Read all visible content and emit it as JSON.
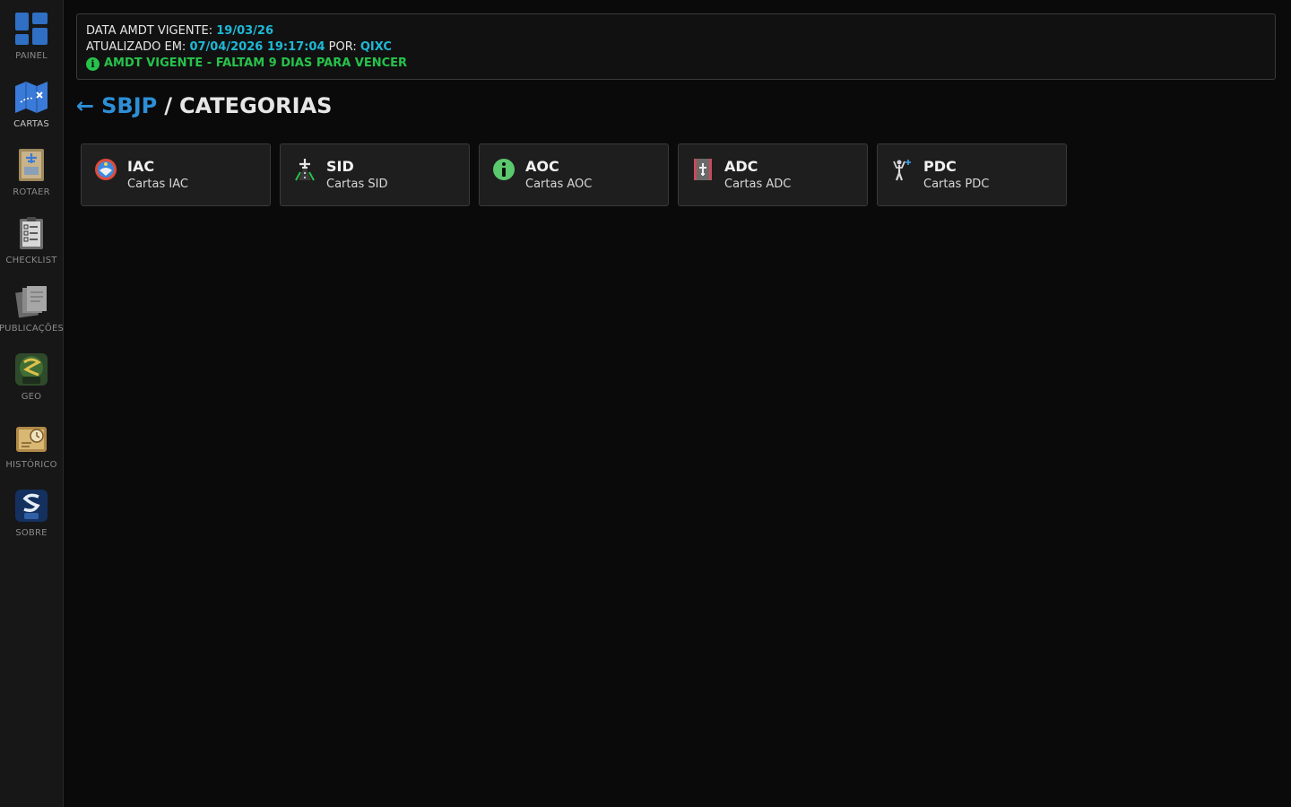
{
  "sidebar": {
    "items": [
      {
        "label": "PAINEL",
        "icon": "dashboard-icon"
      },
      {
        "label": "CARTAS",
        "icon": "map-icon"
      },
      {
        "label": "ROTAER",
        "icon": "rotaer-icon"
      },
      {
        "label": "CHECKLIST",
        "icon": "checklist-icon"
      },
      {
        "label": "PUBLICAÇÕES",
        "icon": "publications-icon"
      },
      {
        "label": "GEO",
        "icon": "sophia-geo-icon"
      },
      {
        "label": "HISTÓRICO",
        "icon": "history-icon"
      },
      {
        "label": "SOBRE",
        "icon": "atc-logo-icon"
      }
    ],
    "active": "CARTAS"
  },
  "info": {
    "amdt_label": "DATA AMDT VIGENTE:",
    "amdt_date": "19/03/26",
    "updated_label": "ATUALIZADO EM:",
    "updated_at": "07/04/2026 19:17:04",
    "by_label": "POR:",
    "by_user": "QIXC",
    "status_icon": "i",
    "status": "AMDT VIGENTE - FALTAM 9 DIAS PARA VENCER"
  },
  "heading": {
    "back_arrow": "←",
    "airport": "SBJP",
    "separator": "/",
    "title": "CATEGORIAS"
  },
  "categories": [
    {
      "title": "IAC",
      "subtitle": "Cartas IAC",
      "icon": "iac-icon"
    },
    {
      "title": "SID",
      "subtitle": "Cartas SID",
      "icon": "sid-icon"
    },
    {
      "title": "AOC",
      "subtitle": "Cartas AOC",
      "icon": "aoc-info-icon"
    },
    {
      "title": "ADC",
      "subtitle": "Cartas ADC",
      "icon": "adc-runway-icon"
    },
    {
      "title": "PDC",
      "subtitle": "Cartas PDC",
      "icon": "pdc-marshaller-icon"
    }
  ],
  "colors": {
    "accent": "#2d8fd6",
    "highlight": "#1fb8d6",
    "status": "#27c24c",
    "background": "#0a0a0a"
  }
}
